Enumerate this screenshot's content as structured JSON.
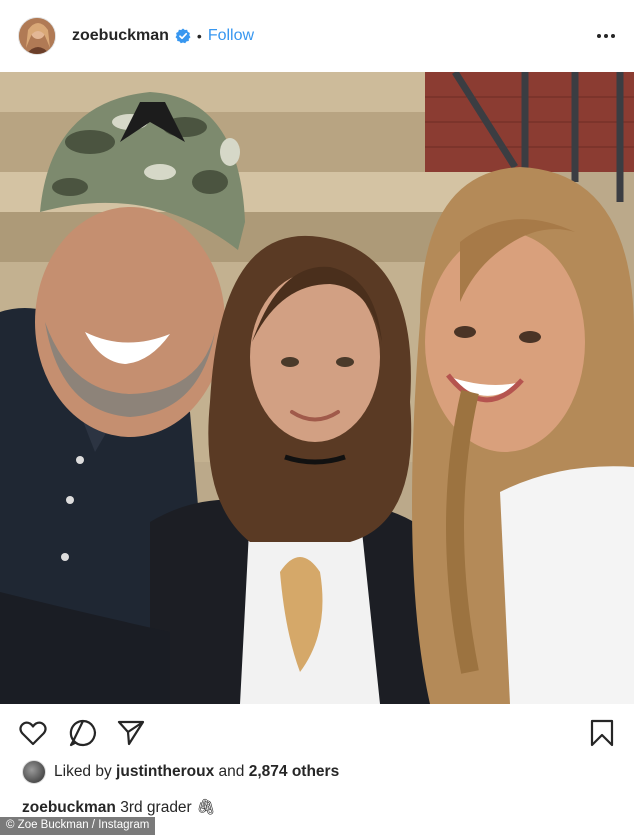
{
  "header": {
    "username": "zoebuckman",
    "dot": "•",
    "follow_label": "Follow"
  },
  "icons": {
    "verified": "verified-badge-icon",
    "more": "more-options-icon",
    "like": "heart-icon",
    "comment": "comment-icon",
    "share": "share-icon",
    "save": "bookmark-icon"
  },
  "colors": {
    "link": "#3897f0",
    "text": "#262626"
  },
  "likes": {
    "prefix": "Liked by",
    "user": "justintheroux",
    "middle": "and",
    "count": "2,874 others"
  },
  "caption": {
    "username": "zoebuckman",
    "text": "3rd grader 🖇"
  },
  "credit": "© Zoe Buckman / Instagram"
}
